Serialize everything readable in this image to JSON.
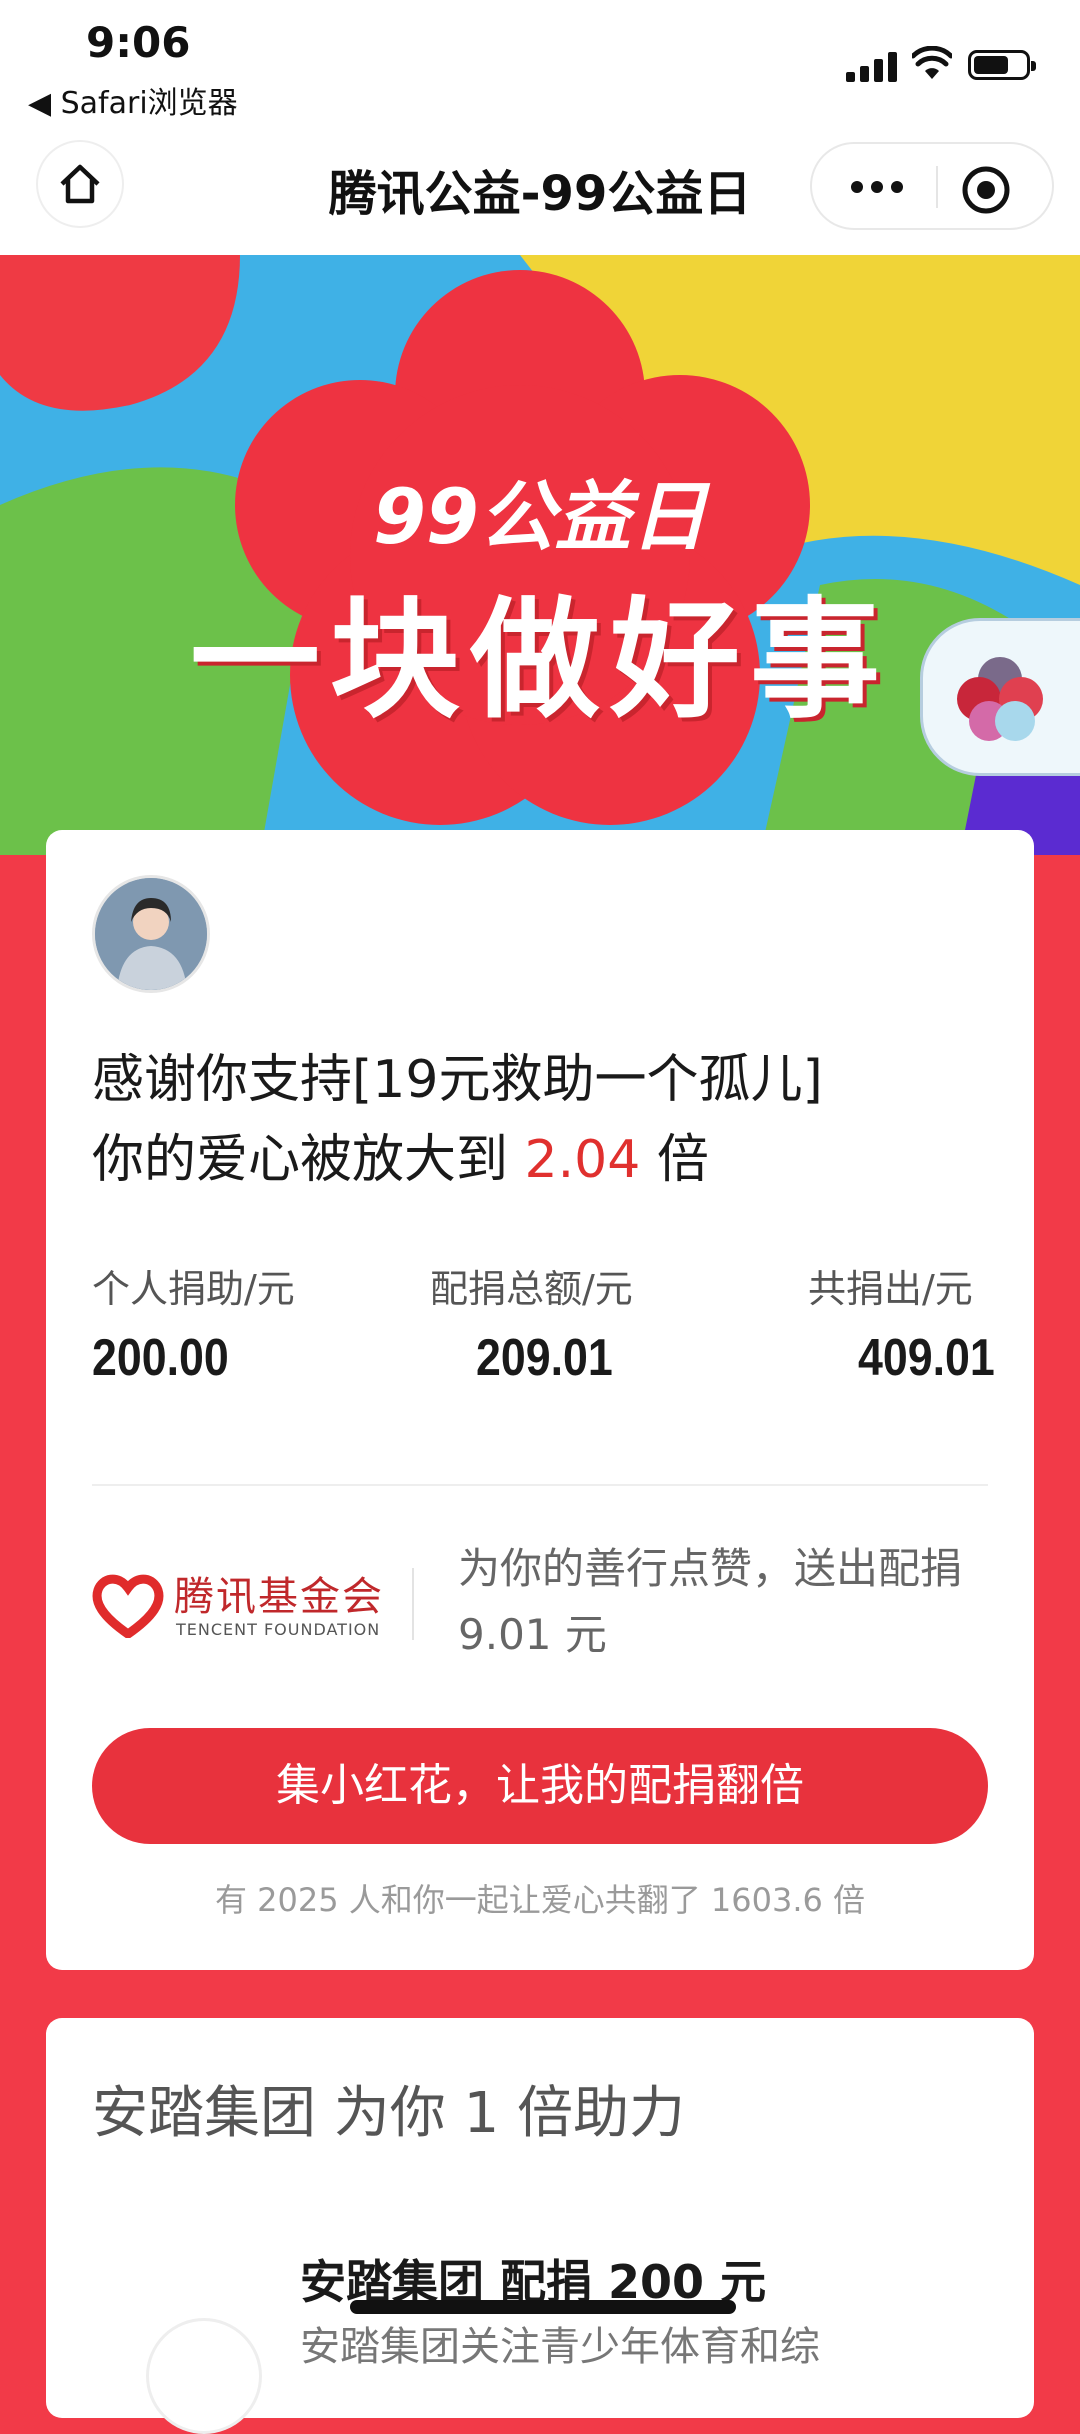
{
  "status": {
    "time": "9:06",
    "back_app": "◀ Safari浏览器"
  },
  "nav": {
    "title": "腾讯公益-99公益日"
  },
  "banner": {
    "line1": "99公益日",
    "line2": "一块做好事"
  },
  "card": {
    "thanks_line1": "感谢你支持[19元救助一个孤儿]",
    "thanks_prefix": "你的爱心被放大到",
    "multiplier": "2.04",
    "thanks_suffix": "倍",
    "stats": [
      {
        "label": "个人捐助/元",
        "value": "200.00"
      },
      {
        "label": "配捐总额/元",
        "value": "209.01"
      },
      {
        "label": "共捐出/元",
        "value": "409.01"
      }
    ],
    "foundation_name_cn": "腾讯基金会",
    "foundation_name_en": "TENCENT FOUNDATION",
    "foundation_msg": "为你的善行点赞，送出配捐 9.01 元",
    "cta_label": "集小红花，让我的配捐翻倍",
    "footnote": "有 2025 人和你一起让爱心共翻了 1603.6 倍"
  },
  "card2": {
    "title": "安踏集团 为你 1 倍助力",
    "sponsor_line": "安踏集团 配捐 200 元",
    "sponsor_desc": "安踏集团关注青少年体育和综"
  },
  "colors": {
    "accent": "#e8323d",
    "highlight": "#e0302e",
    "background": "#f23a48"
  }
}
